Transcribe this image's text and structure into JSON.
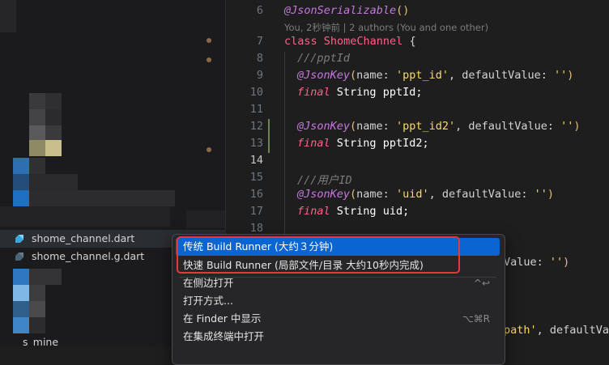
{
  "sidebar": {
    "files": [
      {
        "name": "shome_channel.dart",
        "active": true
      },
      {
        "name": "shome_channel.g.dart",
        "active": false
      },
      {
        "name": "s_mine",
        "active": false
      }
    ]
  },
  "editor": {
    "blame": "You, 2秒钟前 | 2 authors (You and one other)",
    "line_numbers": [
      "6",
      "7",
      "8",
      "9",
      "10",
      "11",
      "12",
      "13",
      "14",
      "15",
      "16",
      "17",
      "18"
    ],
    "lines": {
      "l6": {
        "ann": "@JsonSerializable",
        "paren": "()"
      },
      "l7": {
        "kw": "class",
        "cls": "ShomeChannel",
        "rest": " {"
      },
      "l8": {
        "cm": "///pptId"
      },
      "l9": {
        "ann": "@JsonKey",
        "p1": "(",
        "a": "name: ",
        "s": "'ppt_id'",
        "b": ", defaultValue: ",
        "s2": "''",
        "p2": ")"
      },
      "l10": {
        "kw": "final",
        "type": "String",
        "id": "pptId;"
      },
      "l12": {
        "ann": "@JsonKey",
        "p1": "(",
        "a": "name: ",
        "s": "'ppt_id2'",
        "b": ", defaultValue: ",
        "s2": "''",
        "p2": ")"
      },
      "l13": {
        "kw": "final",
        "type": "String",
        "id": "pptId2;"
      },
      "l15": {
        "cm": "///用户ID"
      },
      "l16": {
        "ann": "@JsonKey",
        "p1": "(",
        "a": "name: ",
        "s": "'uid'",
        "b": ", defaultValue: ",
        "s2": "''",
        "p2": ")"
      },
      "l17": {
        "kw": "final",
        "type": "String",
        "id": "uid;"
      },
      "partial_value": "Value: ",
      "partial_value_str": "''",
      "partial_value_paren": ")",
      "partial_path": "path'",
      "partial_default": ", defaultVa"
    }
  },
  "context_menu": {
    "items": [
      {
        "label": "传统 Build Runner (大约３分钟)",
        "shortcut": ""
      },
      {
        "label": "快速 Build Runner (局部文件/目录 大约10秒内完成)",
        "shortcut": ""
      },
      {
        "label": "在侧边打开",
        "shortcut": "^↩"
      },
      {
        "label": "打开方式...",
        "shortcut": ""
      },
      {
        "label": "在 Finder 中显示",
        "shortcut": "⌥⌘R"
      },
      {
        "label": "在集成终端中打开",
        "shortcut": ""
      }
    ]
  },
  "colors": {
    "selection": "#0a64d2",
    "highlight_box": "#e03a3a"
  }
}
